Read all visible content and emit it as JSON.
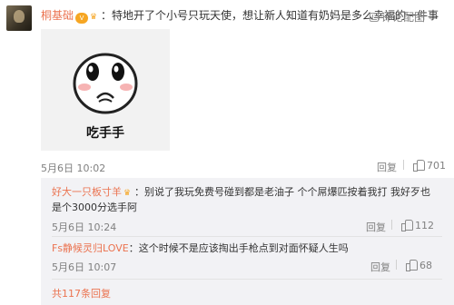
{
  "main_comment": {
    "username": "桐基础",
    "vip_badge": "V",
    "separator": "：",
    "text": "特地开了个小号只玩天使，想让新人知道有奶妈是多么幸福的一件事",
    "report_label": "评论配图",
    "sticker_caption": "吃手手",
    "date": "5月6日 10:02",
    "reply_label": "回复",
    "like_count": "701"
  },
  "replies": [
    {
      "username": "好大一只板寸羊",
      "separator": "：",
      "text": "别说了我玩免费号碰到都是老油子 个个屌爆匹按着我打 我好歹也是个3000分选手阿",
      "date": "5月6日 10:24",
      "reply_label": "回复",
      "like_count": "112"
    },
    {
      "username": "Fs静候灵归LOVE",
      "separator": "：",
      "text": "这个时候不是应该掏出手枪点到对面怀疑人生吗",
      "date": "5月6日 10:07",
      "reply_label": "回复",
      "like_count": "68"
    }
  ],
  "more_replies": "共117条回复",
  "colors": {
    "username": "#eb7350",
    "meta": "#808080",
    "reply_bg": "#f2f2f5"
  },
  "icons": [
    "avatar",
    "vip-icon",
    "crown-icon",
    "report-icon",
    "thumb-up-icon"
  ]
}
